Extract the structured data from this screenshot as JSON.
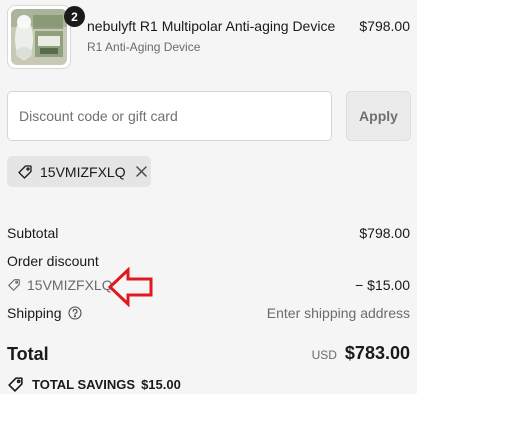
{
  "line_item": {
    "quantity": "2",
    "name": "nebulyft R1 Multipolar Anti-aging Device",
    "variant": "R1 Anti-Aging Device",
    "price": "$798.00"
  },
  "discount_form": {
    "placeholder": "Discount code or gift card",
    "apply_label": "Apply"
  },
  "applied_code": {
    "code": "15VMIZFXLQ"
  },
  "summary": {
    "subtotal_label": "Subtotal",
    "subtotal_value": "$798.00",
    "order_discount_label": "Order discount",
    "discount_code": "15VMIZFXLQ",
    "discount_value": "− $15.00",
    "shipping_label": "Shipping",
    "shipping_value": "Enter shipping address",
    "total_label": "Total",
    "currency": "USD",
    "total_value": "$783.00",
    "savings_label": "TOTAL SAVINGS",
    "savings_value": "$15.00"
  },
  "colors": {
    "annotation_arrow": "#e0191f",
    "panel_background": "#f5f5f5"
  }
}
